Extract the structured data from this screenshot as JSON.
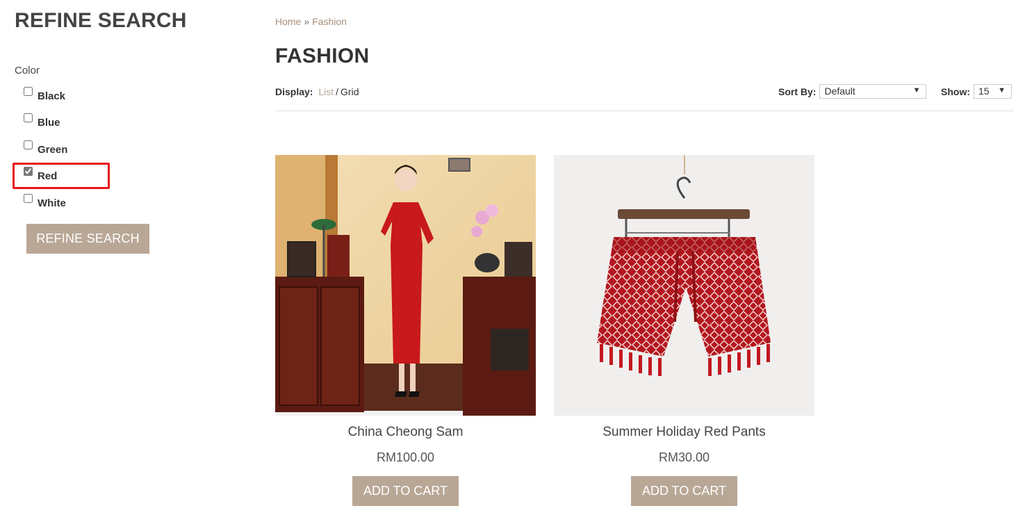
{
  "sidebar": {
    "title": "REFINE SEARCH",
    "color_label": "Color",
    "filters": [
      {
        "label": "Black",
        "checked": false
      },
      {
        "label": "Blue",
        "checked": false
      },
      {
        "label": "Green",
        "checked": false
      },
      {
        "label": "Red",
        "checked": true
      },
      {
        "label": "White",
        "checked": false
      }
    ],
    "refine_button": "REFINE SEARCH"
  },
  "breadcrumb": {
    "home": "Home",
    "separator": "»",
    "current": "Fashion"
  },
  "page_title": "FASHION",
  "toolbar": {
    "display_label": "Display:",
    "list": "List",
    "slash": "/",
    "grid": "Grid",
    "sort_label": "Sort By:",
    "sort_value": "Default",
    "show_label": "Show:",
    "show_value": "15"
  },
  "products": [
    {
      "name": "China Cheong Sam",
      "price": "RM100.00",
      "button": "ADD TO CART"
    },
    {
      "name": "Summer Holiday Red Pants",
      "price": "RM30.00",
      "button": "ADD TO CART"
    }
  ],
  "colors": {
    "accent": "#b9a796",
    "link": "#a88f7b",
    "highlight": "#e8141b"
  }
}
